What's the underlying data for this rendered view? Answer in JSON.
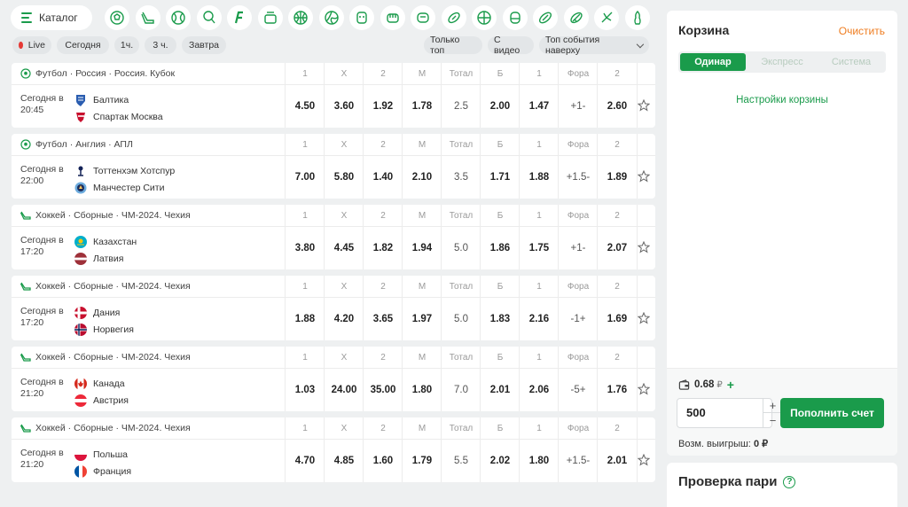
{
  "catalog": {
    "label": "Каталог"
  },
  "sports": [
    {
      "icon": "football-icon"
    },
    {
      "icon": "hockey-icon"
    },
    {
      "icon": "tennis-icon"
    },
    {
      "icon": "table-tennis-icon"
    },
    {
      "icon": "fonbet-icon"
    },
    {
      "icon": "esports-icon"
    },
    {
      "icon": "basketball-icon"
    },
    {
      "icon": "volleyball-icon"
    },
    {
      "icon": "cybersport-icon"
    },
    {
      "icon": "mma-icon"
    },
    {
      "icon": "handball-icon"
    },
    {
      "icon": "rugby-icon"
    },
    {
      "icon": "basketball-3x3-icon"
    },
    {
      "icon": "boxing-icon"
    },
    {
      "icon": "american-football-icon"
    },
    {
      "icon": "cricket-icon"
    },
    {
      "icon": "badminton-icon"
    },
    {
      "icon": "bowling-icon"
    }
  ],
  "filters": {
    "live": "Live",
    "today": "Сегодня",
    "h1": "1ч.",
    "h3": "3 ч.",
    "tomorrow": "Завтра",
    "top_only": "Только топ",
    "with_video": "С видео",
    "sort": "Топ события наверху"
  },
  "columns": [
    "1",
    "X",
    "2",
    "М",
    "Тотал",
    "Б",
    "1",
    "Фора",
    "2"
  ],
  "matches": [
    {
      "league": "Футбол · Россия · Россия. Кубок",
      "sport": "football",
      "time": [
        "Сегодня в",
        "20:45"
      ],
      "team1": "Балтика",
      "team2": "Спартак Москва",
      "odds": [
        "4.50",
        "3.60",
        "1.92",
        "1.78",
        "2.5",
        "2.00",
        "1.47",
        "+1-",
        "2.60"
      ]
    },
    {
      "league": "Футбол · Англия · АПЛ",
      "sport": "football",
      "time": [
        "Сегодня в",
        "22:00"
      ],
      "team1": "Тоттенхэм Хотспур",
      "team2": "Манчестер Сити",
      "odds": [
        "7.00",
        "5.80",
        "1.40",
        "2.10",
        "3.5",
        "1.71",
        "1.88",
        "+1.5-",
        "1.89"
      ]
    },
    {
      "league": "Хоккей · Сборные · ЧМ-2024. Чехия",
      "sport": "hockey",
      "time": [
        "Сегодня в",
        "17:20"
      ],
      "team1": "Казахстан",
      "team2": "Латвия",
      "odds": [
        "3.80",
        "4.45",
        "1.82",
        "1.94",
        "5.0",
        "1.86",
        "1.75",
        "+1-",
        "2.07"
      ]
    },
    {
      "league": "Хоккей · Сборные · ЧМ-2024. Чехия",
      "sport": "hockey",
      "time": [
        "Сегодня в",
        "17:20"
      ],
      "team1": "Дания",
      "team2": "Норвегия",
      "odds": [
        "1.88",
        "4.20",
        "3.65",
        "1.97",
        "5.0",
        "1.83",
        "2.16",
        "-1+",
        "1.69"
      ]
    },
    {
      "league": "Хоккей · Сборные · ЧМ-2024. Чехия",
      "sport": "hockey",
      "time": [
        "Сегодня в",
        "21:20"
      ],
      "team1": "Канада",
      "team2": "Австрия",
      "odds": [
        "1.03",
        "24.00",
        "35.00",
        "1.80",
        "7.0",
        "2.01",
        "2.06",
        "-5+",
        "1.76"
      ]
    },
    {
      "league": "Хоккей · Сборные · ЧМ-2024. Чехия",
      "sport": "hockey",
      "time": [
        "Сегодня в",
        "21:20"
      ],
      "team1": "Польша",
      "team2": "Франция",
      "odds": [
        "4.70",
        "4.85",
        "1.60",
        "1.79",
        "5.5",
        "2.02",
        "1.80",
        "+1.5-",
        "2.01"
      ]
    }
  ],
  "basket": {
    "title": "Корзина",
    "clear": "Очистить",
    "tabs": [
      "Одинар",
      "Экспресс",
      "Система"
    ],
    "settings": "Настройки корзины",
    "balance": "0.68",
    "currency": "₽",
    "amount": "500",
    "plus": "+",
    "minus": "−",
    "topup": "Пополнить счет",
    "win_label": "Возм. выигрыш:",
    "win_value": "0 ₽"
  },
  "check": {
    "title": "Проверка пари",
    "q": "?"
  },
  "colors": {
    "accent": "#1a9b4b",
    "clear": "#ef7d21"
  }
}
